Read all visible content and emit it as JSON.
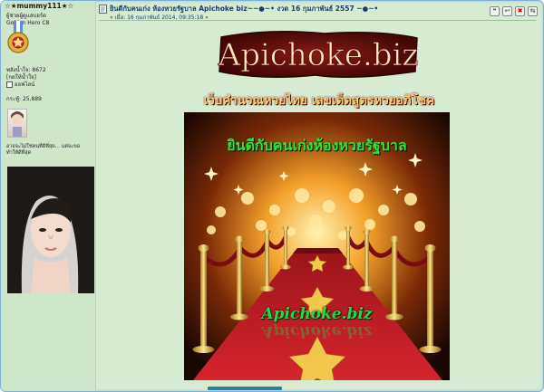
{
  "user": {
    "name": "☆★mummy111★☆",
    "rank": "ผู้ช่วยผู้ดูแลบอร์ด",
    "rank2": "Golden Hero C8",
    "power_label": "พลังน้ำใจ: 8672",
    "give_label": "[กดให้น้ำใจ]",
    "online_label": "ออฟไลน์",
    "posts_label": "กระทู้: 25,889",
    "signature": "อาจจะไม่ใช่คนที่ดีที่สุด... แต่จะขอทำให้ดีที่สุด"
  },
  "post": {
    "title": "ยินดีกับคนเก่ง ห้องหวยรัฐบาล Apichoke biz~~●~• งวด 16 กุมภาพันธ์ 2557 ~●~•",
    "date": "« เมื่อ: 16 กุมภาพันธ์ 2014, 09:35:18 »"
  },
  "logo": {
    "text": "Apichoke.biz"
  },
  "tagline": "เว็บคำนวณหวยไทย เลขเด็ดสูตรหวยอภิโชค",
  "banner": {
    "caption": "ยินดีกับคนเก่งห้องหวยรัฐบาล",
    "site": "Apichoke.biz"
  },
  "toolbar": {
    "icons": [
      "quote-icon",
      "reply-icon",
      "delete-icon",
      "split-icon"
    ]
  },
  "colors": {
    "accent": "#1b3d6e",
    "background": "#d6ebd2",
    "banner_red": "#b01c22",
    "gold": "#f0c24b"
  }
}
